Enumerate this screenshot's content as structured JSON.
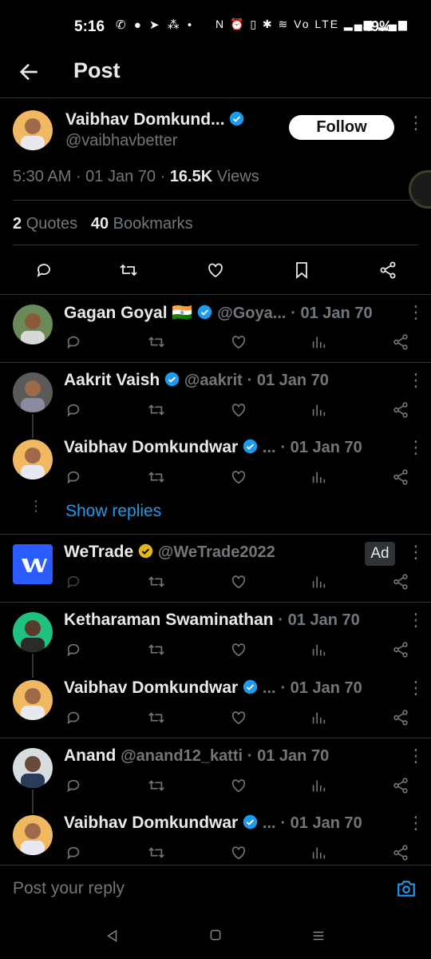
{
  "status": {
    "time": "5:16",
    "left_icons": "✆ ● ➤ ⁂ •",
    "right_icons": "N ⏰ ▯ ✱ ≋ Vo LTE ▂▄▆ ▂▄▆",
    "battery": "49%"
  },
  "header": {
    "title": "Post"
  },
  "post": {
    "author_name": "Vaibhav Domkund...",
    "author_handle": "@vaibhavbetter",
    "follow_label": "Follow",
    "time": "5:30 AM",
    "date": "01 Jan 70",
    "views_count": "16.5K",
    "views_label": "Views",
    "quotes_count": "2",
    "quotes_label": "Quotes",
    "bookmarks_count": "40",
    "bookmarks_label": "Bookmarks"
  },
  "replies": [
    {
      "name": "Gagan Goyal",
      "flag": "🇮🇳",
      "handle": "@Goya...",
      "date": "· 01 Jan 70"
    },
    {
      "name": "Aakrit Vaish",
      "handle": "@aakrit",
      "date": "· 01 Jan 70"
    },
    {
      "name": "Vaibhav Domkundwar",
      "handle": "...",
      "date": "· 01 Jan 70"
    },
    {
      "name": "WeTrade",
      "handle": "@WeTrade2022",
      "badge": "Ad"
    },
    {
      "name": "Ketharaman Swaminathan",
      "date": "· 01 Jan 70"
    },
    {
      "name": "Vaibhav Domkundwar",
      "handle": "...",
      "date": "· 01 Jan 70"
    },
    {
      "name": "Anand",
      "handle": "@anand12_katti",
      "date": "· 01 Jan 70"
    },
    {
      "name": "Vaibhav Domkundwar",
      "handle": "...",
      "date": "· 01 Jan 70"
    }
  ],
  "show_replies_label": "Show replies",
  "composer": {
    "placeholder": "Post your reply"
  },
  "colors": {
    "accent": "#1d9bf0",
    "background": "#000000",
    "muted": "#71767b"
  }
}
